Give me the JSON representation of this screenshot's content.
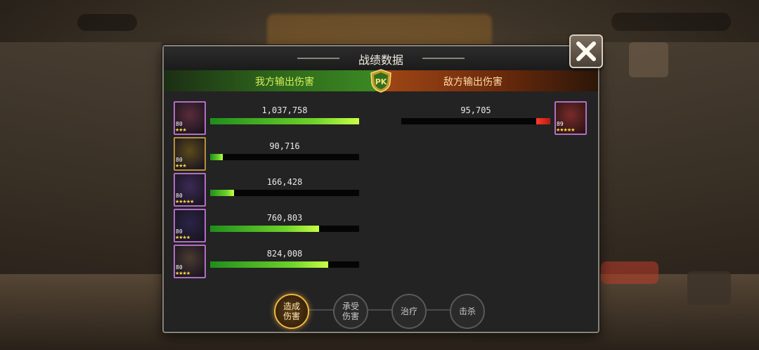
{
  "panel": {
    "title": "战绩数据",
    "ally_header": "我方输出伤害",
    "enemy_header": "敌方输出伤害",
    "pk_badge": "PK"
  },
  "ally": [
    {
      "damage": "1,037,758",
      "fraction": 1.0,
      "level": "80",
      "stars": "★★★",
      "border": "#b06fc2",
      "portrait": "#5a2c3a"
    },
    {
      "damage": "90,716",
      "fraction": 0.087,
      "level": "80",
      "stars": "★★★",
      "border": "#b6903a",
      "portrait": "#5b4a1a"
    },
    {
      "damage": "166,428",
      "fraction": 0.16,
      "level": "80",
      "stars": "★★★★★",
      "border": "#b06fc2",
      "portrait": "#3b2a55"
    },
    {
      "damage": "760,803",
      "fraction": 0.733,
      "level": "80",
      "stars": "★★★★",
      "border": "#b06fc2",
      "portrait": "#2a2448"
    },
    {
      "damage": "824,008",
      "fraction": 0.794,
      "level": "80",
      "stars": "★★★★",
      "border": "#b06fc2",
      "portrait": "#4a3a30"
    }
  ],
  "enemy": [
    {
      "damage": "95,705",
      "fraction": 0.092,
      "level": "89",
      "stars": "★★★★★",
      "border": "#b06fc2",
      "portrait": "#7a2a2a"
    }
  ],
  "tabs": [
    {
      "label": "造成\n伤害",
      "active": true
    },
    {
      "label": "承受\n伤害",
      "active": false
    },
    {
      "label": "治疗",
      "active": false
    },
    {
      "label": "击杀",
      "active": false
    }
  ],
  "colors": {
    "ally_bar": "#6fd32a",
    "enemy_bar": "#e0261a",
    "tab_active_border": "#f2b540"
  },
  "icons": {
    "close": "close-x-icon",
    "pk": "pk-shield-icon"
  }
}
